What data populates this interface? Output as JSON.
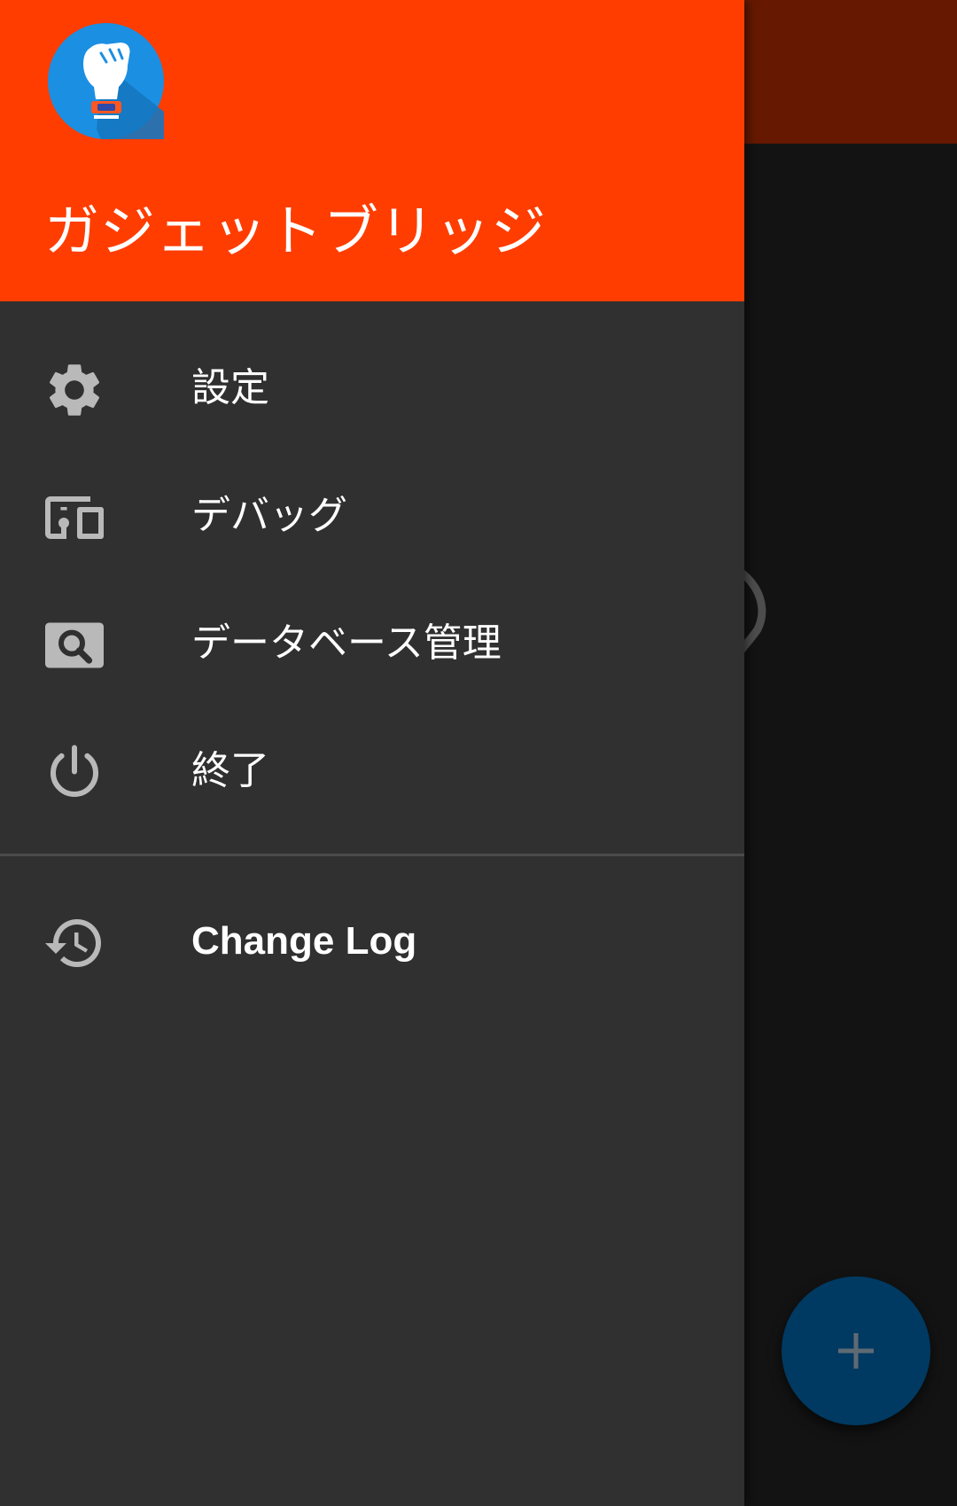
{
  "drawer": {
    "app_name": "ガジェットブリッジ",
    "header_color": "#ff3d00",
    "logo_icon": "raised-fist-icon",
    "items": [
      {
        "label": "設定",
        "icon": "gear-icon"
      },
      {
        "label": "デバッグ",
        "icon": "devices-icon"
      },
      {
        "label": "データベース管理",
        "icon": "image-search-icon"
      },
      {
        "label": "終了",
        "icon": "power-icon"
      }
    ],
    "secondary_items": [
      {
        "label": "Change Log",
        "icon": "history-icon"
      }
    ]
  },
  "background": {
    "toolbar_color": "#661900",
    "fab_icon": "plus-icon",
    "fab_color": "#003a62"
  }
}
